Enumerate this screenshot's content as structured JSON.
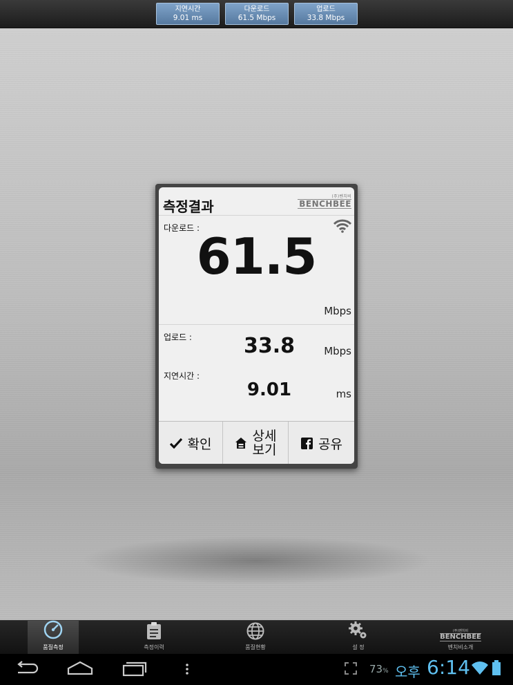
{
  "top_stats": [
    {
      "label": "지연시간",
      "value": "9.01 ms"
    },
    {
      "label": "다운로드",
      "value": "61.5 Mbps"
    },
    {
      "label": "업로드",
      "value": "33.8 Mbps"
    }
  ],
  "result": {
    "title": "측정결과",
    "logo_small": "(주)벤치비",
    "logo": "BENCHBEE",
    "download_label": "다운로드 :",
    "download_value": "61.5",
    "download_unit": "Mbps",
    "upload_label": "업로드 :",
    "upload_value": "33.8",
    "upload_unit": "Mbps",
    "latency_label": "지연시간 :",
    "latency_value": "9.01",
    "latency_unit": "ms",
    "buttons": {
      "confirm": "확인",
      "detail_line1": "상세",
      "detail_line2": "보기",
      "share": "공유"
    }
  },
  "tabs": {
    "quality_test": "품질측정",
    "history": "측정이력",
    "status": "품질현황",
    "settings": "설 정",
    "about_logo_small": "(주)벤치비",
    "about_logo": "BENCHBEE",
    "about": "벤치비소개"
  },
  "status_bar": {
    "battery": "73",
    "ampm": "오후",
    "time": "6:14"
  },
  "colors": {
    "accent": "#5fc0f0",
    "stat_box": "#6b8fb6"
  }
}
